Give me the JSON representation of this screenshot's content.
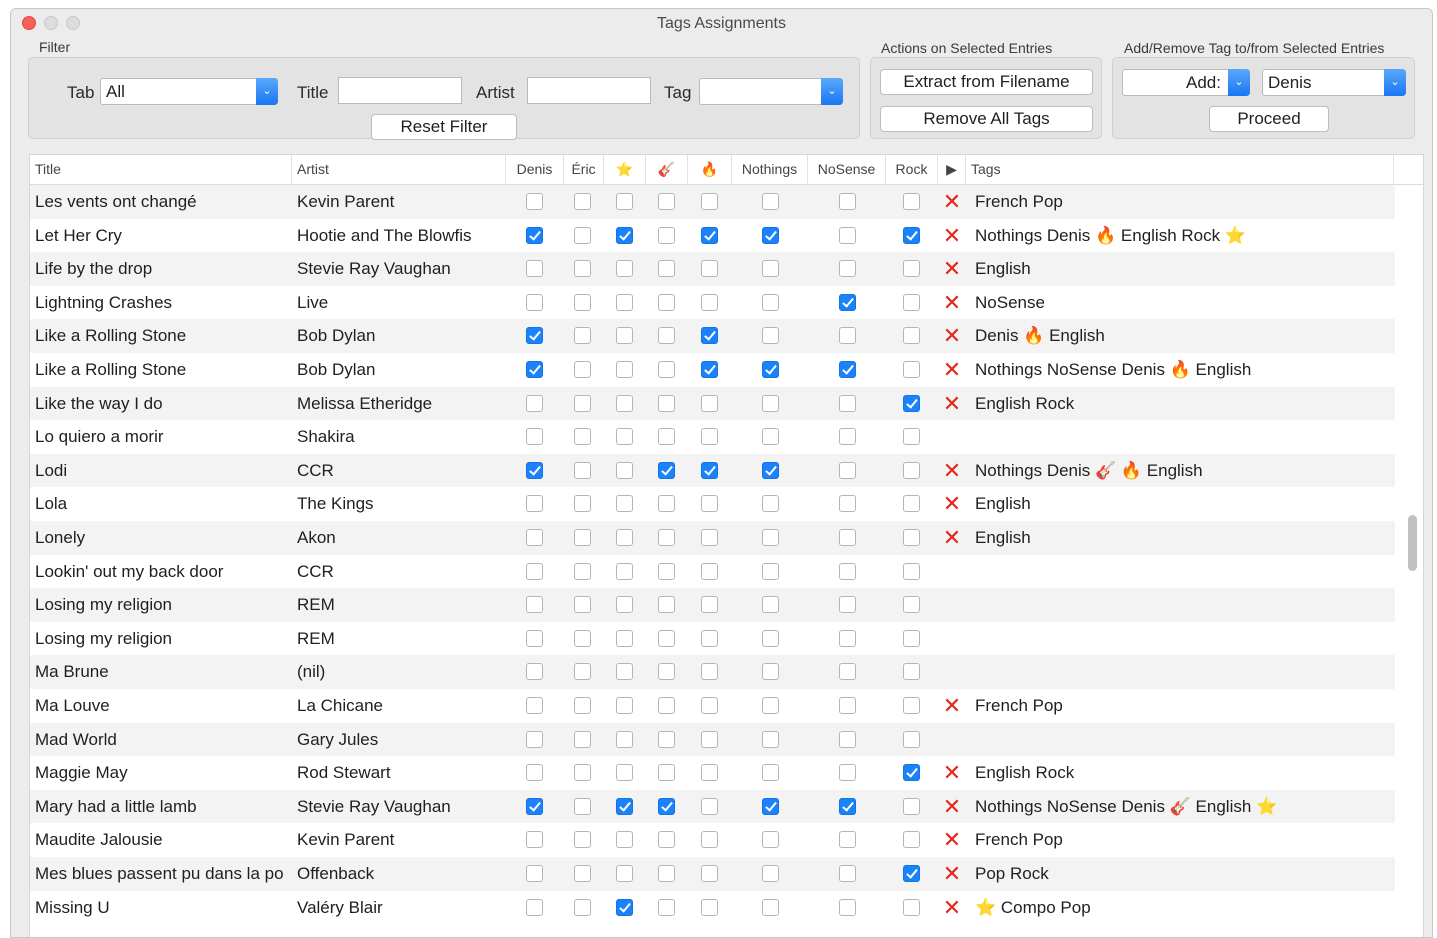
{
  "window": {
    "title": "Tags Assignments"
  },
  "filter": {
    "label": "Filter",
    "tab_label": "Tab",
    "tab_value": "All",
    "title_label": "Title",
    "title_value": "",
    "artist_label": "Artist",
    "artist_value": "",
    "tag_label": "Tag",
    "tag_value": "",
    "reset_button": "Reset Filter"
  },
  "actions": {
    "label": "Actions on Selected Entries",
    "extract_button": "Extract from Filename",
    "remove_button": "Remove All Tags"
  },
  "addremove": {
    "label": "Add/Remove Tag to/from Selected Entries",
    "mode_value": "Add:",
    "tag_value": "Denis",
    "proceed_button": "Proceed"
  },
  "columns": [
    "Title",
    "Artist",
    "Denis",
    "Éric",
    "⭐",
    "🎸",
    "🔥",
    "Nothings",
    "NoSense",
    "Rock",
    "▶",
    "Tags"
  ],
  "rows": [
    {
      "title": "Les vents ont changé",
      "artist": "Kevin Parent",
      "checks": [
        0,
        0,
        0,
        0,
        0,
        0,
        0,
        0
      ],
      "x": true,
      "tags": "French Pop"
    },
    {
      "title": "Let Her Cry",
      "artist": "Hootie and The Blowfis",
      "checks": [
        1,
        0,
        1,
        0,
        1,
        1,
        0,
        1
      ],
      "x": true,
      "tags": "Nothings Denis 🔥 English Rock ⭐"
    },
    {
      "title": "Life by the drop",
      "artist": "Stevie Ray Vaughan",
      "checks": [
        0,
        0,
        0,
        0,
        0,
        0,
        0,
        0
      ],
      "x": true,
      "tags": "English"
    },
    {
      "title": "Lightning Crashes",
      "artist": "Live",
      "checks": [
        0,
        0,
        0,
        0,
        0,
        0,
        1,
        0
      ],
      "x": true,
      "tags": "NoSense"
    },
    {
      "title": "Like a Rolling Stone",
      "artist": "Bob Dylan",
      "checks": [
        1,
        0,
        0,
        0,
        1,
        0,
        0,
        0
      ],
      "x": true,
      "tags": "Denis 🔥 English"
    },
    {
      "title": "Like a Rolling Stone",
      "artist": "Bob Dylan",
      "checks": [
        1,
        0,
        0,
        0,
        1,
        1,
        1,
        0
      ],
      "x": true,
      "tags": "Nothings NoSense Denis 🔥 English"
    },
    {
      "title": "Like the way I do",
      "artist": "Melissa Etheridge",
      "checks": [
        0,
        0,
        0,
        0,
        0,
        0,
        0,
        1
      ],
      "x": true,
      "tags": "English Rock"
    },
    {
      "title": "Lo quiero a morir",
      "artist": "Shakira",
      "checks": [
        0,
        0,
        0,
        0,
        0,
        0,
        0,
        0
      ],
      "x": false,
      "tags": ""
    },
    {
      "title": "Lodi",
      "artist": "CCR",
      "checks": [
        1,
        0,
        0,
        1,
        1,
        1,
        0,
        0
      ],
      "x": true,
      "tags": "Nothings Denis 🎸 🔥 English"
    },
    {
      "title": "Lola",
      "artist": "The Kings",
      "checks": [
        0,
        0,
        0,
        0,
        0,
        0,
        0,
        0
      ],
      "x": true,
      "tags": "English"
    },
    {
      "title": "Lonely",
      "artist": "Akon",
      "checks": [
        0,
        0,
        0,
        0,
        0,
        0,
        0,
        0
      ],
      "x": true,
      "tags": "English"
    },
    {
      "title": "Lookin' out my back door",
      "artist": "CCR",
      "checks": [
        0,
        0,
        0,
        0,
        0,
        0,
        0,
        0
      ],
      "x": false,
      "tags": ""
    },
    {
      "title": "Losing my religion",
      "artist": "REM",
      "checks": [
        0,
        0,
        0,
        0,
        0,
        0,
        0,
        0
      ],
      "x": false,
      "tags": ""
    },
    {
      "title": "Losing my religion",
      "artist": "REM",
      "checks": [
        0,
        0,
        0,
        0,
        0,
        0,
        0,
        0
      ],
      "x": false,
      "tags": ""
    },
    {
      "title": "Ma Brune",
      "artist": "(nil)",
      "checks": [
        0,
        0,
        0,
        0,
        0,
        0,
        0,
        0
      ],
      "x": false,
      "tags": ""
    },
    {
      "title": "Ma Louve",
      "artist": "La Chicane",
      "checks": [
        0,
        0,
        0,
        0,
        0,
        0,
        0,
        0
      ],
      "x": true,
      "tags": "French Pop"
    },
    {
      "title": "Mad World",
      "artist": "Gary Jules",
      "checks": [
        0,
        0,
        0,
        0,
        0,
        0,
        0,
        0
      ],
      "x": false,
      "tags": ""
    },
    {
      "title": "Maggie May",
      "artist": "Rod Stewart",
      "checks": [
        0,
        0,
        0,
        0,
        0,
        0,
        0,
        1
      ],
      "x": true,
      "tags": "English Rock"
    },
    {
      "title": "Mary had a little lamb",
      "artist": "Stevie Ray Vaughan",
      "checks": [
        1,
        0,
        1,
        1,
        0,
        1,
        1,
        0
      ],
      "x": true,
      "tags": "Nothings NoSense Denis 🎸 English ⭐"
    },
    {
      "title": "Maudite Jalousie",
      "artist": "Kevin Parent",
      "checks": [
        0,
        0,
        0,
        0,
        0,
        0,
        0,
        0
      ],
      "x": true,
      "tags": "French Pop"
    },
    {
      "title": "Mes blues passent pu dans la po",
      "artist": "Offenback",
      "checks": [
        0,
        0,
        0,
        0,
        0,
        0,
        0,
        1
      ],
      "x": true,
      "tags": "Pop Rock"
    },
    {
      "title": "Missing U",
      "artist": "Valéry Blair",
      "checks": [
        0,
        0,
        1,
        0,
        0,
        0,
        0,
        0
      ],
      "x": true,
      "tags": "⭐ Compo Pop"
    }
  ]
}
